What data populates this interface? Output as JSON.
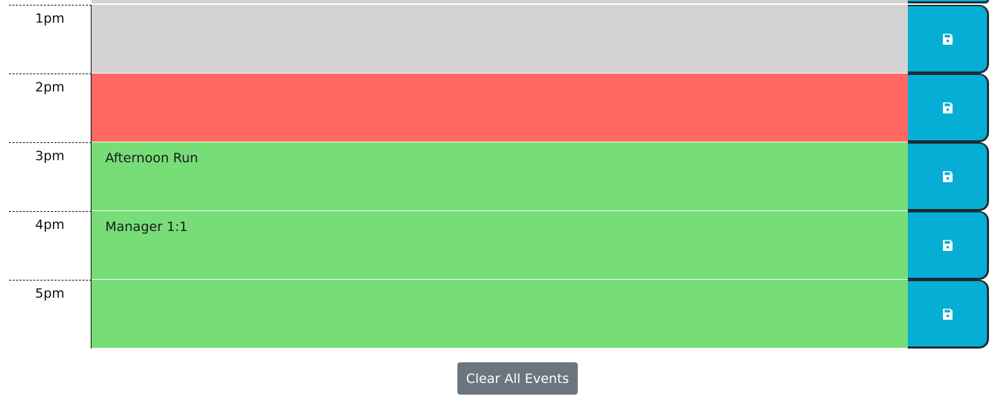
{
  "time_blocks": [
    {
      "hour": "1pm",
      "description": "",
      "state": "past"
    },
    {
      "hour": "2pm",
      "description": "",
      "state": "present"
    },
    {
      "hour": "3pm",
      "description": "Afternoon Run",
      "state": "future"
    },
    {
      "hour": "4pm",
      "description": "Manager 1:1",
      "state": "future"
    },
    {
      "hour": "5pm",
      "description": "",
      "state": "future"
    }
  ],
  "save_icon": "floppy-disk-icon",
  "clear_button": {
    "label": "Clear All Events"
  },
  "colors": {
    "past": "#d3d3d3",
    "present": "#ff6961",
    "future": "#77dd77",
    "save_button": "#06aed5",
    "clear_button": "#6c757d"
  }
}
